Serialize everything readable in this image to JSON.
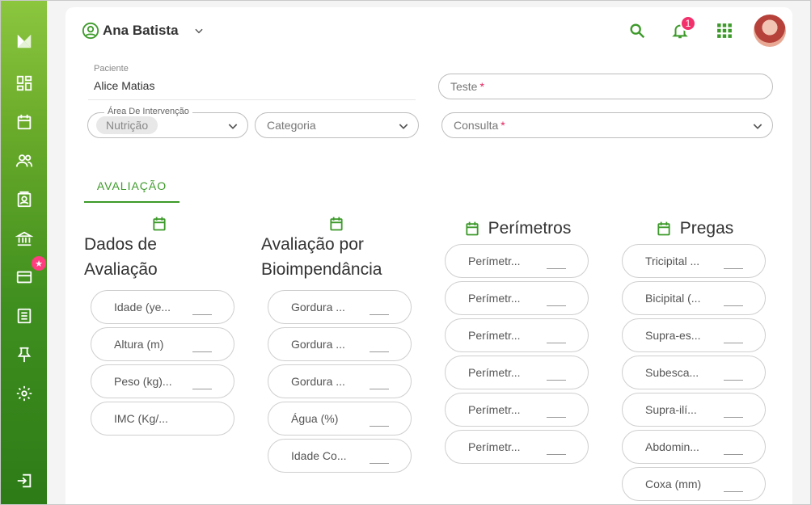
{
  "colors": {
    "accent": "#3d9a2a",
    "badge": "#f2306c"
  },
  "sidebar": {
    "items": [
      {
        "icon": "logo-icon"
      },
      {
        "icon": "dashboard-icon"
      },
      {
        "icon": "calendar-icon"
      },
      {
        "icon": "users-icon"
      },
      {
        "icon": "contacts-icon"
      },
      {
        "icon": "bank-icon"
      },
      {
        "icon": "card-icon"
      },
      {
        "icon": "list-icon"
      },
      {
        "icon": "pin-icon"
      },
      {
        "icon": "gear-icon"
      },
      {
        "icon": "logout-icon"
      }
    ],
    "card_badge_icon": "star-icon"
  },
  "header": {
    "user_name": "Ana Batista",
    "notification_count": "1"
  },
  "form": {
    "paciente_label": "Paciente",
    "paciente_value": "Alice Matias",
    "teste_placeholder": "Teste",
    "teste_required": "*",
    "area_label": "Área De Intervenção",
    "area_value": "Nutrição",
    "categoria_placeholder": "Categoria",
    "consulta_placeholder": "Consulta",
    "consulta_required": "*"
  },
  "tabs": [
    {
      "label": "AVALIAÇÃO"
    }
  ],
  "sections": [
    {
      "title_line1": "Dados de",
      "title_line2": "Avaliação",
      "fields": [
        "Idade (ye...",
        "Altura (m)",
        "Peso (kg)...",
        "IMC (Kg/..."
      ]
    },
    {
      "title_line1": "Avaliação por",
      "title_line2": "Bioimpendância",
      "fields": [
        "Gordura ...",
        "Gordura ...",
        "Gordura ...",
        "Água (%)",
        "Idade Co..."
      ]
    },
    {
      "title": "Perímetros",
      "fields": [
        "Perímetr...",
        "Perímetr...",
        "Perímetr...",
        "Perímetr...",
        "Perímetr...",
        "Perímetr..."
      ]
    },
    {
      "title": "Pregas",
      "fields": [
        "Tricipital ...",
        "Bicipital (...",
        "Supra-es...",
        "Subesca...",
        "Supra-ilí...",
        "Abdomin...",
        "Coxa (mm)"
      ]
    }
  ]
}
